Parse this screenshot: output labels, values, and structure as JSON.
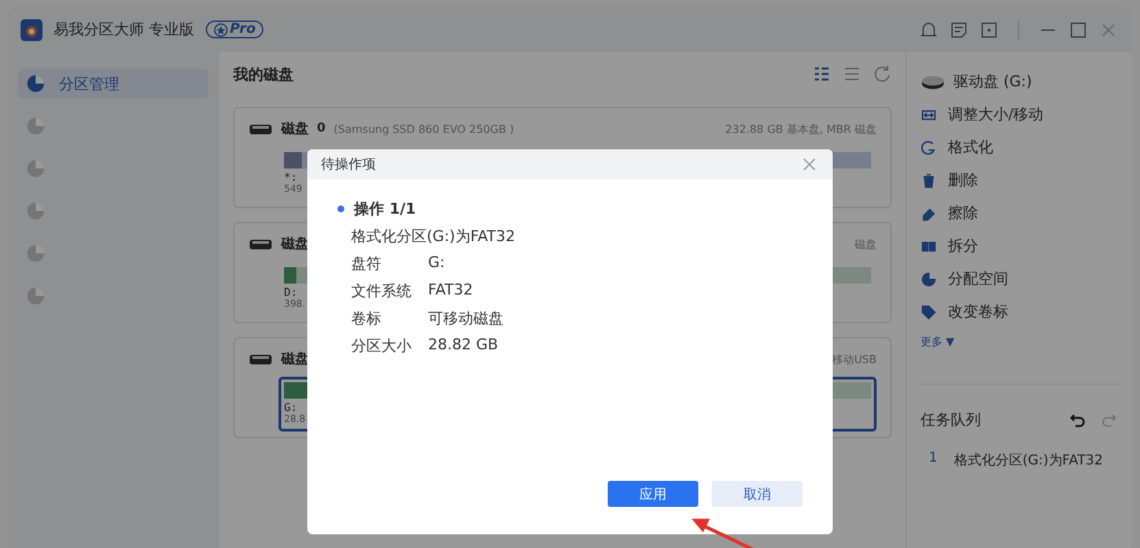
{
  "window": {
    "title": "易我分区大师 专业版",
    "badge": "Pro"
  },
  "sidebar": {
    "items": [
      {
        "label": "分区管理",
        "selected": true
      },
      {
        "selected": false
      },
      {
        "selected": false
      },
      {
        "selected": false
      },
      {
        "selected": false
      },
      {
        "selected": false
      }
    ]
  },
  "main": {
    "title": "我的磁盘",
    "disks": [
      {
        "name": "磁盘",
        "number": "0",
        "model": "(Samsung SSD 860 EVO 250GB )",
        "info": "232.88 GB 基本盘, MBR 磁盘",
        "partition": {
          "letter": "*:",
          "size": "549",
          "level": 0.03,
          "selected": false
        }
      },
      {
        "name": "磁盘",
        "info": "磁盘",
        "partition": {
          "letter": "D:",
          "size": "398.",
          "level": 0.02,
          "selected": false
        }
      },
      {
        "name": "磁盘",
        "info": "移动USB",
        "partition": {
          "letter": "G:",
          "size": "28.8",
          "level": 0.04,
          "selected": true
        }
      }
    ]
  },
  "right_panel": {
    "drive": "驱动盘 (G:)",
    "actions": [
      {
        "label": "调整大小/移动",
        "kind": "resize"
      },
      {
        "label": "格式化",
        "kind": "format"
      },
      {
        "label": "删除",
        "kind": "delete"
      },
      {
        "label": "擦除",
        "kind": "wipe"
      },
      {
        "label": "拆分",
        "kind": "split"
      },
      {
        "label": "分配空间",
        "kind": "allocate"
      },
      {
        "label": "改变卷标",
        "kind": "label"
      }
    ],
    "more": "更多",
    "more_caret": "▼",
    "queue": {
      "title": "任务队列",
      "items": [
        {
          "index": "1",
          "text": "格式化分区(G:)为FAT32"
        }
      ]
    }
  },
  "dialog": {
    "title": "待操作项",
    "heading": "操作 1/1",
    "description": "格式化分区(G:)为FAT32",
    "rows": [
      {
        "key": "盘符",
        "value": "G:"
      },
      {
        "key": "文件系统",
        "value": "FAT32"
      },
      {
        "key": "卷标",
        "value": "可移动磁盘"
      },
      {
        "key": "分区大小",
        "value": "28.82 GB"
      }
    ],
    "buttons": [
      {
        "label": "应用",
        "kind": "primary"
      },
      {
        "label": "取消",
        "kind": "secondary"
      }
    ]
  }
}
